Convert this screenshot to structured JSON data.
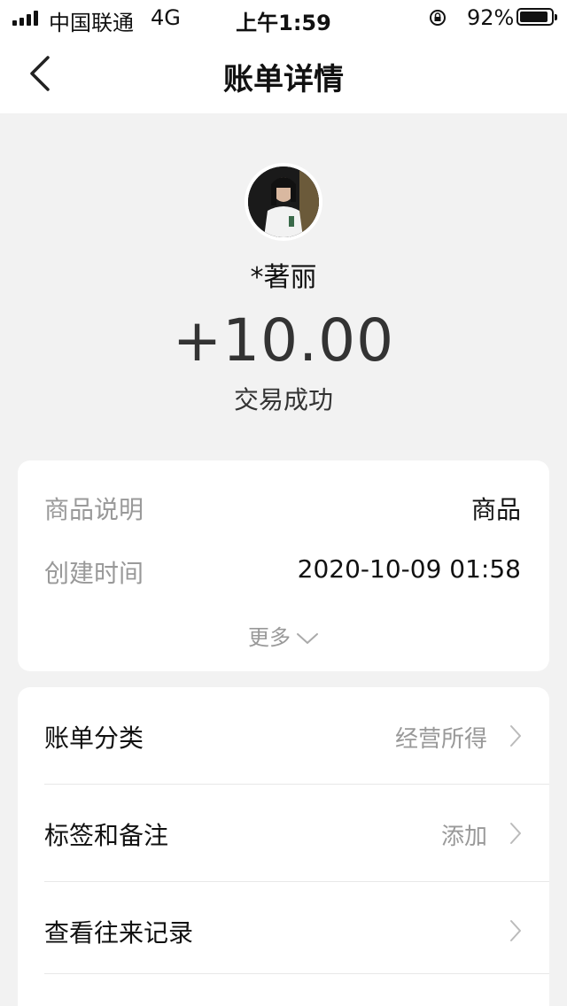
{
  "status_bar": {
    "carrier": "中国联通",
    "network": "4G",
    "time": "上午1:59",
    "battery_percent": "92%",
    "battery_level": 0.92
  },
  "nav": {
    "title": "账单详情",
    "back_icon": "chevron-left-icon"
  },
  "payer": {
    "name": "*著丽"
  },
  "transaction": {
    "amount": "+10.00",
    "status": "交易成功"
  },
  "details": [
    {
      "label": "商品说明",
      "value": "商品"
    },
    {
      "label": "创建时间",
      "value": "2020-10-09 01:58"
    }
  ],
  "more": {
    "label": "更多",
    "icon": "chevron-down-icon"
  },
  "actions": [
    {
      "label": "账单分类",
      "value": "经营所得"
    },
    {
      "label": "标签和备注",
      "value": "添加"
    },
    {
      "label": "查看往来记录",
      "value": ""
    }
  ],
  "colors": {
    "background": "#f2f2f2",
    "card": "#ffffff",
    "muted_text": "#999999",
    "primary_text": "#111111"
  }
}
